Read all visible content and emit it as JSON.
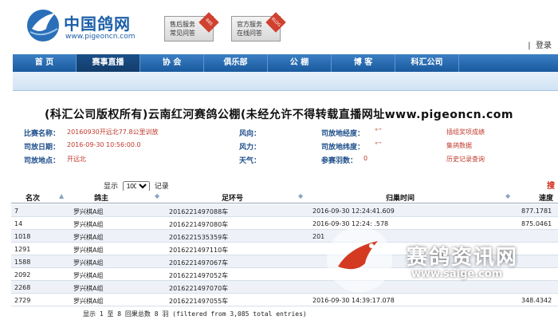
{
  "brand": {
    "name": "中国鸽网",
    "url": "www.pigeoncn.com"
  },
  "header": {
    "svc1": {
      "line1": "售后服务",
      "line2": "常见问答",
      "tag": "BBS"
    },
    "svc2": {
      "line1": "官方服务",
      "line2": "在线问答",
      "tag": "BLOG"
    },
    "login": "登录",
    "login_sep": "|"
  },
  "nav": [
    "首 页",
    "赛事直播",
    "协 会",
    "俱乐部",
    "公 棚",
    "博 客",
    "科汇公司"
  ],
  "title": "(科汇公司版权所有)云南红河赛鸽公棚(未经允许不得转载直播网址www.pigeoncn.com",
  "info": {
    "r1": {
      "l1": "比赛名称：",
      "v1": "20160930开远北77.8公里训放",
      "l2": "风向：",
      "l3": "司放地经度：",
      "v3": "°′″",
      "link": "插组奖项成绩"
    },
    "r2": {
      "l1": "司放日期：",
      "v1": "2016-09-30 10:56:00.0",
      "l2": "风力：",
      "l3": "司放地纬度：",
      "v3": "°′″",
      "link": "集鸽数据"
    },
    "r3": {
      "l1": "司放地点：",
      "v1": "开远北",
      "l2": "天气：",
      "l3": "参赛羽数：",
      "v3": "0",
      "link": "历史记录查询"
    }
  },
  "show": {
    "pre": "显示",
    "value": "100",
    "post": "记录"
  },
  "search": "搜",
  "table": {
    "headers": [
      "名次",
      "鸽主",
      "足环号",
      "归巢时间",
      "速度"
    ],
    "rows": [
      [
        "7",
        "罗兴棋A组",
        "2016221497088车",
        "2016-09-30 12:24:41.609",
        "877.1781"
      ],
      [
        "14",
        "罗兴棋A组",
        "2016221497080车",
        "2016-09-30 12:24:  .578",
        "875.0461"
      ],
      [
        "1018",
        "罗兴棋A组",
        "2016221535359车",
        "201",
        ""
      ],
      [
        "1291",
        "罗兴棋A组",
        "2016221497110车",
        "",
        ""
      ],
      [
        "1588",
        "罗兴棋A组",
        "2016221497067车",
        "",
        ""
      ],
      [
        "2092",
        "罗兴棋A组",
        "2016221497052车",
        "",
        ""
      ],
      [
        "2268",
        "罗兴棋A组",
        "2016221497070车",
        "",
        ""
      ],
      [
        "2729",
        "罗兴棋A组",
        "2016221497055车",
        "2016-09-30 14:39:17.078",
        "348.4342"
      ]
    ]
  },
  "footer": "显示 1 至 8 回果总数 8 羽 (filtered from 3,085 total entries)",
  "watermark": {
    "text": "赛鸽资讯网",
    "url": "www.saige.com"
  }
}
